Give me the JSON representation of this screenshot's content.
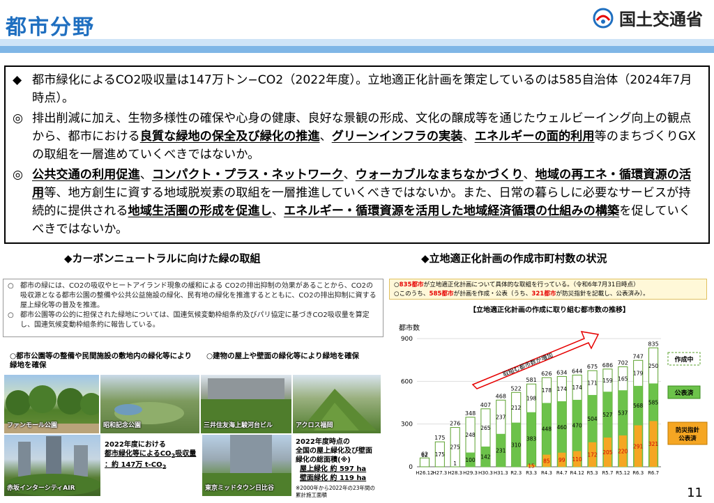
{
  "header": {
    "title": "都市分野",
    "ministry": "国土交通省"
  },
  "summary": {
    "p1": {
      "bullet": "◆",
      "parts": [
        {
          "t": "都市緑化によるCO2吸収量は147万トン−CO2（2022年度）。立地適正化計画を策定しているのは585自治体（2024年7月時点）。",
          "u": false
        }
      ]
    },
    "p2": {
      "bullet": "◎",
      "parts": [
        {
          "t": "排出削減に加え、生物多様性の確保や心身の健康、良好な景観の形成、文化の醸成等を通じたウェルビーイング向上の観点から、都市における",
          "u": false
        },
        {
          "t": "良質な緑地の保全及び緑化の推進",
          "u": true
        },
        {
          "t": "、",
          "u": false
        },
        {
          "t": "グリーンインフラの実装",
          "u": true
        },
        {
          "t": "、",
          "u": false
        },
        {
          "t": "エネルギーの面的利用",
          "u": true
        },
        {
          "t": "等のまちづくりGXの取組を一層進めていくべきではないか。",
          "u": false
        }
      ]
    },
    "p3": {
      "bullet": "◎",
      "parts": [
        {
          "t": "公共交通の利用促進",
          "u": true
        },
        {
          "t": "、",
          "u": false
        },
        {
          "t": "コンパクト・プラス・ネットワーク",
          "u": true
        },
        {
          "t": "、",
          "u": false
        },
        {
          "t": "ウォーカブルなまちなかづくり",
          "u": true
        },
        {
          "t": "、",
          "u": false
        },
        {
          "t": "地域の再エネ・循環資源の活用",
          "u": true
        },
        {
          "t": "等、地方創生に資する地域脱炭素の取組を一層推進していくべきではないか。また、日常の暮らしに必要なサービスが持続的に提供される",
          "u": false
        },
        {
          "t": "地域生活圏の形成を促進し",
          "u": true
        },
        {
          "t": "、",
          "u": false
        },
        {
          "t": "エネルギー・循環資源を活用した地域経済循環の仕組みの構築",
          "u": true
        },
        {
          "t": "を促していくべきではないか。",
          "u": false
        }
      ]
    }
  },
  "left": {
    "heading": "◆カーボンニュートラルに向けた緑の取組",
    "notes": [
      {
        "mark": "○",
        "text": "都市の緑には、CO2の吸収やヒートアイランド現象の緩和による CO2の排出抑制の効果があることから、CO2の吸収源となる都市公園の整備や公共公益施設の緑化、民有地の緑化を推進するとともに、CO2の排出抑制に資する屋上緑化等の普及を推進。"
      },
      {
        "mark": "○",
        "text": "都市公園等の公的に担保された緑地については、国連気候変動枠組条約及びパリ協定に基づきCO2吸収量を算定し、国連気候変動枠組条約に報告している。"
      }
    ],
    "sub1": "○都市公園等の整備や民間施設の敷地内の緑化等により緑地を確保",
    "sub2": "○建物の屋上や壁面の緑化等により緑地を確保",
    "photos": {
      "p1": "ファンモール公園",
      "p2": "昭和記念公園",
      "p3": "三井住友海上駿河台ビル",
      "p4": "アクロス福岡",
      "p5": "赤坂インターシティAIR",
      "p6": "東京ミッドタウン日比谷"
    },
    "info1": {
      "l1": "2022年度における",
      "l2": "都市緑化等によるCO",
      "l2sub": "2",
      "l2end": "吸収量",
      "l3": "：約 147万 t-CO",
      "l3sub": "2"
    },
    "info2": {
      "l1": "2022年度時点の",
      "l2": "全国の屋上緑化及び壁面",
      "l3": "緑化の総面積",
      "l3note": "(※)",
      "l4": "屋上緑化 約 597 ha",
      "l5": "壁面緑化 約 119 ha",
      "l6": "※2000年から2022年の23年間の",
      "l7": "累計施工面積"
    }
  },
  "right": {
    "heading": "◆立地適正化計画の作成市町村数の状況",
    "note1a": "○",
    "note1b": "835都市",
    "note1c": "が立地適正化計画について具体的な取組を行っている。（令和6年7月31日時点）",
    "note2a": "○このうち、",
    "note2b": "585都市",
    "note2c": "が計画を作成・公表（うち、",
    "note2d": "321都市",
    "note2e": "が防災指針を記載し、公表済み）。"
  },
  "chart_data": {
    "type": "bar",
    "title": "【立地適正化計画の作成に取り組む都市数の推移】",
    "ylabel": "都市数",
    "ylim": [
      0,
      900
    ],
    "yticks": [
      0,
      300,
      600,
      900
    ],
    "categories": [
      "H26.12",
      "H27.3",
      "H28.3",
      "H29.3",
      "H30.3",
      "H31.3",
      "R2.3",
      "R3.3",
      "R4.3",
      "R4.7",
      "R4.12",
      "R5.3",
      "R5.7",
      "R5.12",
      "R6.3",
      "R6.7"
    ],
    "totals": [
      62,
      175,
      276,
      348,
      407,
      468,
      522,
      581,
      626,
      634,
      644,
      675,
      686,
      702,
      747,
      835
    ],
    "series": [
      {
        "name": "作成中",
        "color": "#ffffff",
        "stroke": "#5aa02c",
        "values": [
          62,
          175,
          275,
          248,
          265,
          237,
          212,
          198,
          178,
          174,
          174,
          171,
          159,
          165,
          179,
          250
        ]
      },
      {
        "name": "公表済",
        "color": "#6cc24a",
        "values": [
          0,
          0,
          1,
          100,
          142,
          231,
          310,
          383,
          448,
          460,
          470,
          504,
          527,
          537,
          568,
          585
        ]
      },
      {
        "name": "防災指針公表済",
        "color": "#f5a623",
        "values": [
          0,
          0,
          0,
          0,
          0,
          0,
          0,
          15,
          85,
          99,
          110,
          172,
          205,
          220,
          291,
          321
        ]
      }
    ],
    "annotation": "取組む都市数が増加",
    "legend_placement": "right"
  },
  "page_number": "11",
  "colors": {
    "title": "#1f6fc0",
    "band_light": "#cfe4f7",
    "band_dark": "#7fb6e6",
    "red": "#e60000"
  }
}
